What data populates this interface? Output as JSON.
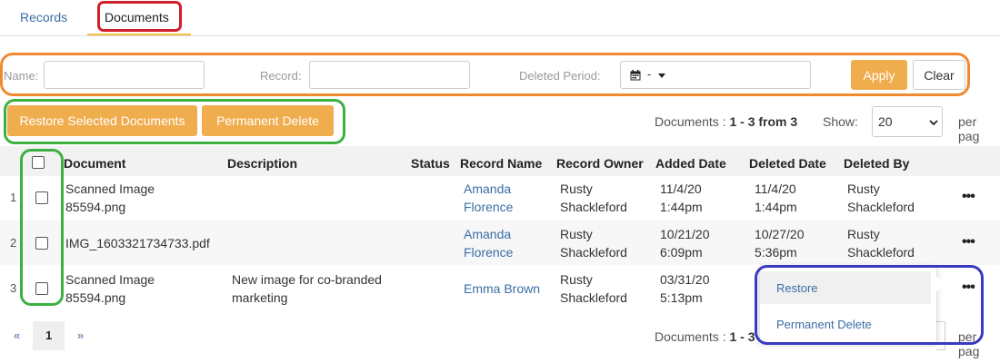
{
  "tabs": {
    "records": "Records",
    "documents": "Documents"
  },
  "filters": {
    "name_label": "Name:",
    "name_value": "",
    "record_label": "Record:",
    "record_value": "",
    "deleted_period_label": "Deleted Period:",
    "deleted_period_value": "-",
    "apply_label": "Apply",
    "clear_label": "Clear"
  },
  "actions": {
    "restore_selected_label": "Restore Selected Documents",
    "permanent_delete_label": "Permanent Delete",
    "count_prefix": "Documents :",
    "count_value": "1 - 3 from 3",
    "count_value_bottom": "1 - 3",
    "show_label": "Show:",
    "show_value": "20",
    "per_page_label": "per pag"
  },
  "table": {
    "headers": {
      "document": "Document",
      "description": "Description",
      "status": "Status",
      "record_name": "Record Name",
      "record_owner": "Record Owner",
      "added_date": "Added Date",
      "deleted_date": "Deleted Date",
      "deleted_by": "Deleted By"
    },
    "rows": [
      {
        "num": "1",
        "doc1": "Scanned Image",
        "doc2": "85594.png",
        "desc1": "",
        "desc2": "",
        "status": "",
        "rec1": "Amanda",
        "rec2": "Florence",
        "own1": "Rusty",
        "own2": "Shackleford",
        "add1": "11/4/20",
        "add2": "1:44pm",
        "del1": "11/4/20",
        "del2": "1:44pm",
        "by1": "Rusty",
        "by2": "Shackleford"
      },
      {
        "num": "2",
        "doc1": "IMG_1603321734733.pdf",
        "doc2": "",
        "desc1": "",
        "desc2": "",
        "status": "",
        "rec1": "Amanda",
        "rec2": "Florence",
        "own1": "Rusty",
        "own2": "Shackleford",
        "add1": "10/21/20",
        "add2": "6:09pm",
        "del1": "10/27/20",
        "del2": "5:36pm",
        "by1": "Rusty",
        "by2": "Shackleford"
      },
      {
        "num": "3",
        "doc1": "Scanned Image",
        "doc2": "85594.png",
        "desc1": "New image for co-branded",
        "desc2": "marketing",
        "status": "",
        "rec1": "Emma Brown",
        "rec2": "",
        "own1": "Rusty",
        "own2": "Shackleford",
        "add1": "03/31/20",
        "add2": "5:13pm",
        "del1": "",
        "del2": "",
        "by1": "",
        "by2": ""
      }
    ]
  },
  "row_menu": {
    "restore": "Restore",
    "permanent_delete": "Permanent Delete"
  },
  "pagination": {
    "prev": "«",
    "current": "1",
    "next": "»"
  },
  "colors": {
    "accent_orange": "#f0ad4e",
    "link_blue": "#3a6ea5",
    "annotation_red": "#d0202a",
    "annotation_orange": "#f08a30",
    "annotation_green": "#3cb043",
    "annotation_blue": "#3a3ac0"
  }
}
